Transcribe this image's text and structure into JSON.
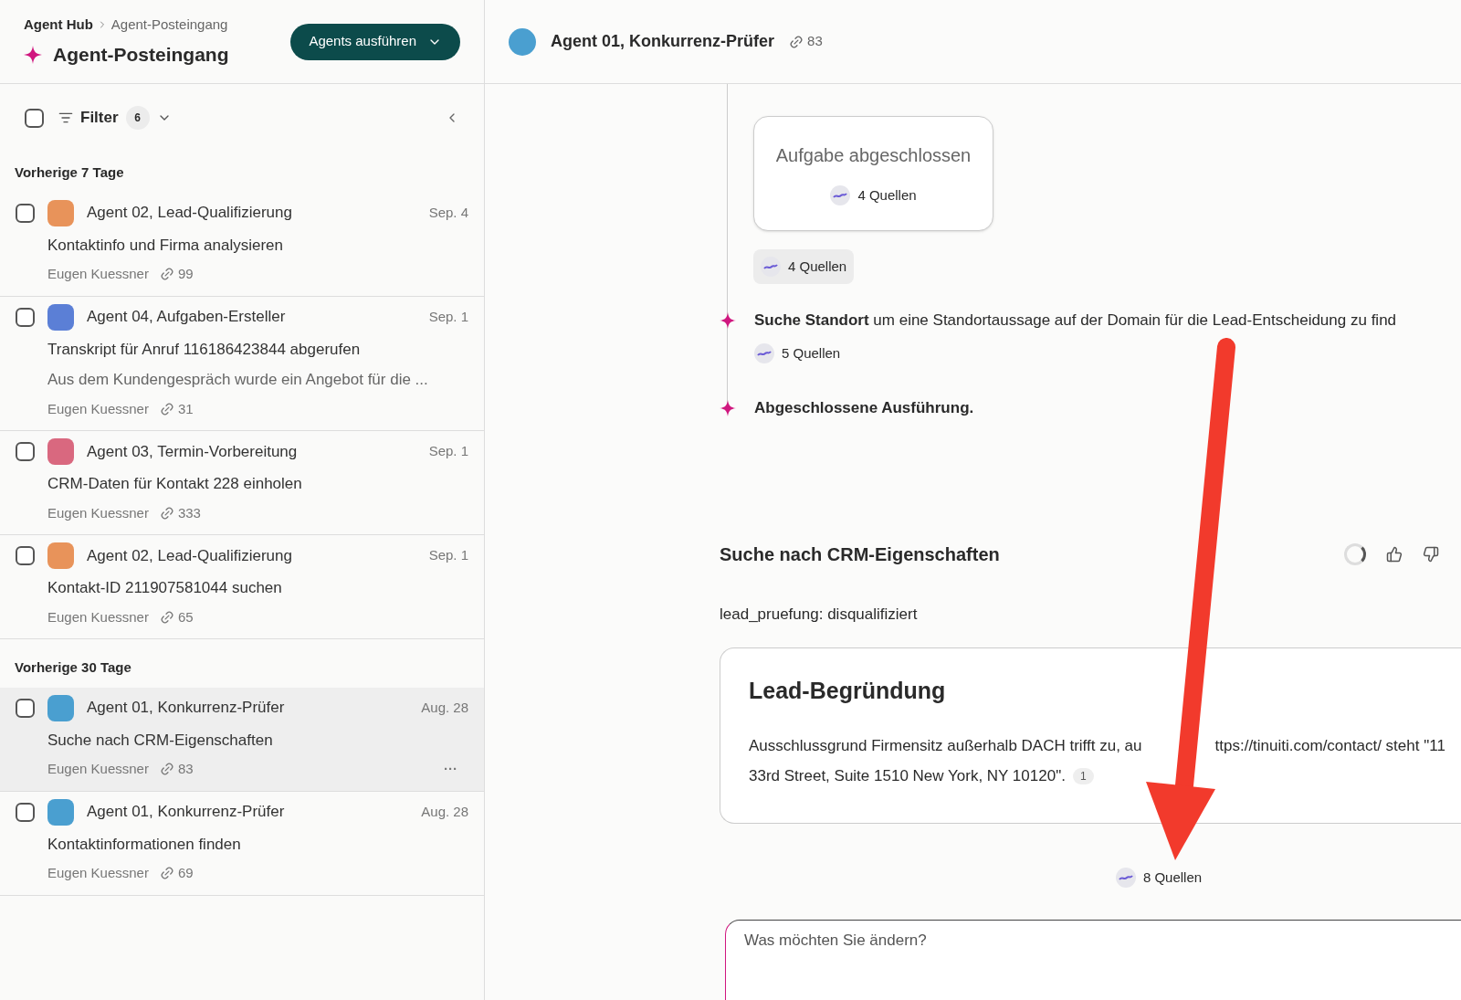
{
  "breadcrumb": [
    "Agent Hub",
    "Agent-Posteingang"
  ],
  "page_title": "Agent-Posteingang",
  "run_button": "Agents ausführen",
  "filter": {
    "checked": false,
    "label": "Filter",
    "count": "6"
  },
  "groups": [
    {
      "title": "Vorherige 7 Tage",
      "items": [
        {
          "agent": "Agent 02, Lead-Qualifizierung",
          "date": "Sep. 4",
          "task": "Kontaktinfo und Firma analysieren",
          "owner": "Eugen Kuessner",
          "links": "99",
          "checked": false,
          "selected": false,
          "color": "#e8935a"
        },
        {
          "agent": "Agent 04, Aufgaben-Ersteller",
          "date": "Sep. 1",
          "task": "Transkript für Anruf 116186423844 abgerufen",
          "preview": "Aus dem Kundengespräch wurde ein Angebot für die ...",
          "owner": "Eugen Kuessner",
          "links": "31",
          "checked": false,
          "selected": false,
          "color": "#5b7fd6"
        },
        {
          "agent": "Agent 03, Termin-Vorbereitung",
          "date": "Sep. 1",
          "task": "CRM-Daten für Kontakt 228 einholen",
          "owner": "Eugen Kuessner",
          "links": "333",
          "checked": false,
          "selected": false,
          "color": "#d9687f"
        },
        {
          "agent": "Agent 02, Lead-Qualifizierung",
          "date": "Sep. 1",
          "task": "Kontakt-ID 211907581044 suchen",
          "owner": "Eugen Kuessner",
          "links": "65",
          "checked": false,
          "selected": false,
          "color": "#e8935a"
        }
      ]
    },
    {
      "title": "Vorherige 30 Tage",
      "items": [
        {
          "agent": "Agent 01, Konkurrenz-Prüfer",
          "date": "Aug. 28",
          "task": "Suche nach CRM-Eigenschaften",
          "owner": "Eugen Kuessner",
          "links": "83",
          "checked": false,
          "selected": true,
          "more": "···",
          "color": "#4a9fd0"
        },
        {
          "agent": "Agent 01, Konkurrenz-Prüfer",
          "date": "Aug. 28",
          "task": "Kontaktinformationen finden",
          "owner": "Eugen Kuessner",
          "links": "69",
          "checked": false,
          "selected": false,
          "color": "#4a9fd0"
        }
      ]
    }
  ],
  "detail": {
    "agent": "Agent 01, Konkurrenz-Prüfer",
    "links": "83",
    "result_card": {
      "title": "Aufgabe abgeschlossen",
      "sources": "4 Quellen"
    },
    "sources_chip": "4 Quellen",
    "steps": [
      {
        "bold": "Suche Standort",
        "text": "um eine Standortaussage auf der Domain für die Lead-Entscheidung zu find",
        "sources": "5 Quellen"
      },
      {
        "bold": "Abgeschlossene Ausführung."
      }
    ],
    "section_title": "Suche nach CRM-Eigenschaften",
    "property": "lead_pruefung: disqualifiziert",
    "reason_card": {
      "title": "Lead-Begründung",
      "lines": [
        "Ausschlussgrund Firmensitz außerhalb DACH trifft zu, au",
        "ttps://tinuiti.com/contact/ steht \"11",
        "33rd Street, Suite 1510 New York, NY 10120\"."
      ],
      "citation": "1"
    },
    "total_sources": "8 Quellen",
    "input": {
      "placeholder": "Was möchten Sie ändern?"
    }
  }
}
